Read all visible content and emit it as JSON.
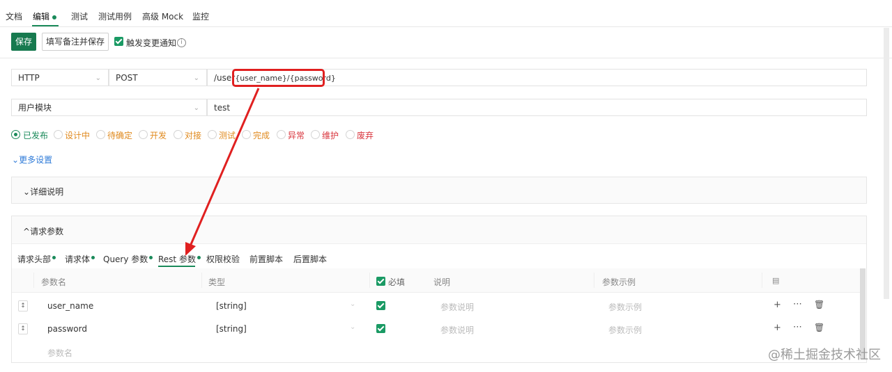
{
  "top_tabs": [
    "文档",
    "编辑",
    "测试",
    "测试用例",
    "高级 Mock",
    "监控"
  ],
  "toolbar": {
    "save_label": "保存",
    "save_with_note_label": "填写备注并保存",
    "notify_label": "触发变更通知",
    "notify_checked": true
  },
  "request": {
    "protocol": "HTTP",
    "method": "POST",
    "path_prefix": "/user",
    "path_params": "{user_name}/{password}",
    "module": "用户模块",
    "name": "test"
  },
  "statuses": [
    {
      "label": "已发布",
      "color": "#1a8a5a",
      "selected": true
    },
    {
      "label": "设计中",
      "color": "#e08a1e",
      "selected": false
    },
    {
      "label": "待确定",
      "color": "#e08a1e",
      "selected": false
    },
    {
      "label": "开发",
      "color": "#e08a1e",
      "selected": false
    },
    {
      "label": "对接",
      "color": "#e08a1e",
      "selected": false
    },
    {
      "label": "测试",
      "color": "#e08a1e",
      "selected": false
    },
    {
      "label": "完成",
      "color": "#e08a1e",
      "selected": false
    },
    {
      "label": "异常",
      "color": "#d9363e",
      "selected": false
    },
    {
      "label": "维护",
      "color": "#d9363e",
      "selected": false
    },
    {
      "label": "废弃",
      "color": "#d9363e",
      "selected": false
    }
  ],
  "more_settings_label": "更多设置",
  "detail_panel_title": "详细说明",
  "params_panel_title": "请求参数",
  "param_tabs": [
    "请求头部",
    "请求体",
    "Query 参数",
    "Rest 参数",
    "权限校验",
    "前置脚本",
    "后置脚本"
  ],
  "table": {
    "headers": {
      "name": "参数名",
      "type": "类型",
      "required": "必填",
      "desc": "说明",
      "example": "参数示例"
    },
    "rows": [
      {
        "name": "user_name",
        "type": "[string]",
        "required": true,
        "desc_placeholder": "参数说明",
        "example_placeholder": "参数示例"
      },
      {
        "name": "password",
        "type": "[string]",
        "required": true,
        "desc_placeholder": "参数说明",
        "example_placeholder": "参数示例"
      }
    ],
    "new_row_placeholder": "参数名"
  },
  "watermark": "@稀土掘金技术社区",
  "colors": {
    "accent": "#1a8a5a",
    "highlight": "#e02020"
  }
}
